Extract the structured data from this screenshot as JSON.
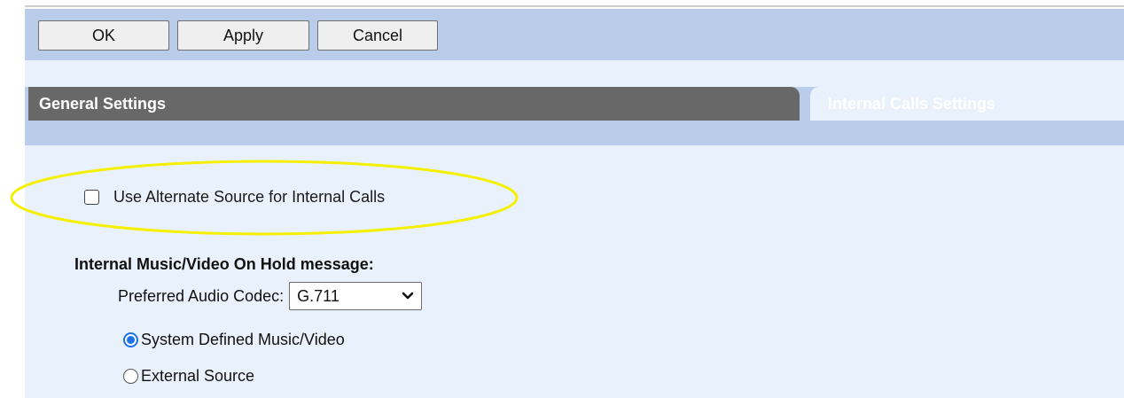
{
  "toolbar": {
    "ok_label": "OK",
    "apply_label": "Apply",
    "cancel_label": "Cancel"
  },
  "tabs": {
    "general": "General Settings",
    "internal": "Internal Calls Settings"
  },
  "alternate_source": {
    "label": "Use Alternate Source for Internal Calls",
    "checked": false
  },
  "moh": {
    "title": "Internal Music/Video On Hold message:",
    "codec_label": "Preferred Audio Codec:",
    "codec_value": "G.711",
    "options": [
      {
        "label": "System Defined Music/Video",
        "selected": true
      },
      {
        "label": "External Source",
        "selected": false
      }
    ]
  },
  "colors": {
    "highlight": "#f5f000",
    "toolbar_bg": "#b9cce9",
    "panel_bg": "#e9f2fc",
    "tab_active_bg": "#686868",
    "radio_accent": "#1a73e8"
  },
  "icons": {
    "dropdown": "chevron-down-icon"
  }
}
